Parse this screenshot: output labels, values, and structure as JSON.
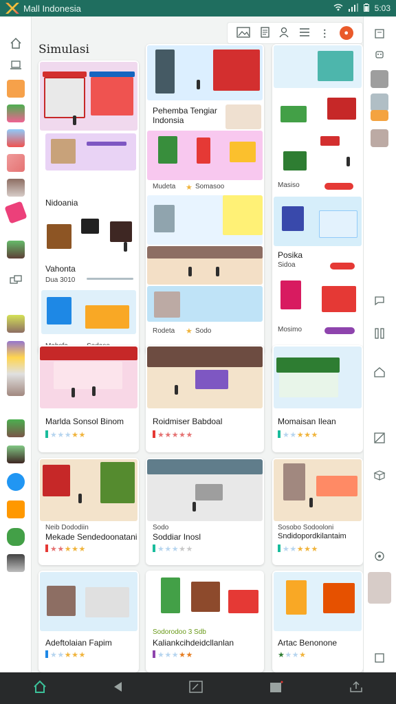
{
  "status": {
    "app_title": "Mall Indonesia",
    "time": "5:03",
    "wifi": "wifi-icon",
    "signal": "signal-icon",
    "battery": "battery-icon"
  },
  "page": {
    "title": "Simulasi"
  },
  "colors": {
    "statusbar": "#1f6e5f",
    "accent": "#3cc29a",
    "star": "#f0b43c",
    "star_off": "#b7d5ef",
    "avatar": "#ea5a2a"
  },
  "toolbar": {
    "icons": [
      "image-icon",
      "document-icon",
      "user-icon",
      "list-icon",
      "more-icon"
    ],
    "avatar_letter": "●"
  },
  "cards": [
    {
      "title": "Nidoania",
      "sub": "",
      "rating": ""
    },
    {
      "title": "Vahonta",
      "sub": "Dua 3010",
      "rating": ""
    },
    {
      "title": "Mahsfa",
      "sub": "Sedaso",
      "rating": ""
    },
    {
      "title": "Pehemba Tengiar Indonsia",
      "sub": "",
      "rating": ""
    },
    {
      "title": "Mudeta",
      "sub": "Somasoo",
      "rating": ""
    },
    {
      "title": "Rodeta",
      "sub": "Sodo",
      "rating": ""
    },
    {
      "title": "Masiso",
      "sub": "",
      "rating": ""
    },
    {
      "title": "Posika",
      "sub": "Sidoa",
      "rating": ""
    },
    {
      "title": "Mosimo",
      "sub": "",
      "rating": ""
    },
    {
      "title": "Marlda Sonsol Binom",
      "sub": "",
      "rating": "★★★★★"
    },
    {
      "title": "Roidmiser Babdoal",
      "sub": "",
      "rating": "★★★★★"
    },
    {
      "title": "Momaisan Ilean",
      "sub": "",
      "rating": "★★★★★"
    },
    {
      "title": "Mekade Sendedoonatani",
      "sub": "Neib Dododiin",
      "rating": "★★★★★"
    },
    {
      "title": "Soddiar Inosl",
      "sub": "Sodo",
      "rating": "★★★★★"
    },
    {
      "title": "Sndidopordkilantaim",
      "sub": "Sosobo Sodooloni",
      "rating": "★★★★★"
    },
    {
      "title": "Adeftolaian Fapim",
      "sub": "",
      "rating": "★★★★★"
    },
    {
      "title": "Kaliankcihdeidcllanlan",
      "sub": "Sodorodoo 3 Sdb",
      "rating": "★★★★★"
    },
    {
      "title": "Artac Benonone",
      "sub": "",
      "rating": "★★★★★"
    }
  ],
  "nav": {
    "home": "home-icon",
    "back": "back-icon",
    "edit": "edit-icon",
    "recent": "recent-icon",
    "share": "share-icon"
  }
}
